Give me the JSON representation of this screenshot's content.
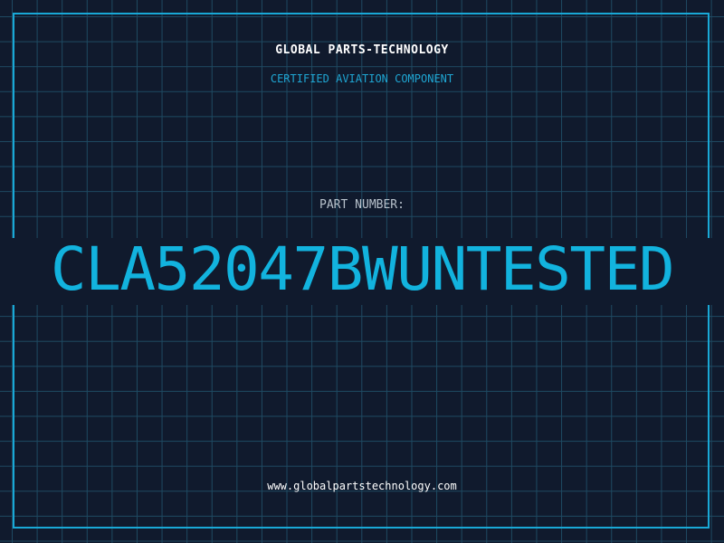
{
  "header": {
    "company": "GLOBAL PARTS-TECHNOLOGY",
    "subtitle": "CERTIFIED AVIATION COMPONENT"
  },
  "part": {
    "label": "PART NUMBER:",
    "number": "CLA52047BWUNTESTED"
  },
  "footer": {
    "website": "www.globalpartstechnology.com"
  },
  "colors": {
    "background": "#101a2d",
    "grid": "#1e4a62",
    "accent": "#19a8d6",
    "heading": "#ffffff",
    "label": "#b8c2cc"
  }
}
